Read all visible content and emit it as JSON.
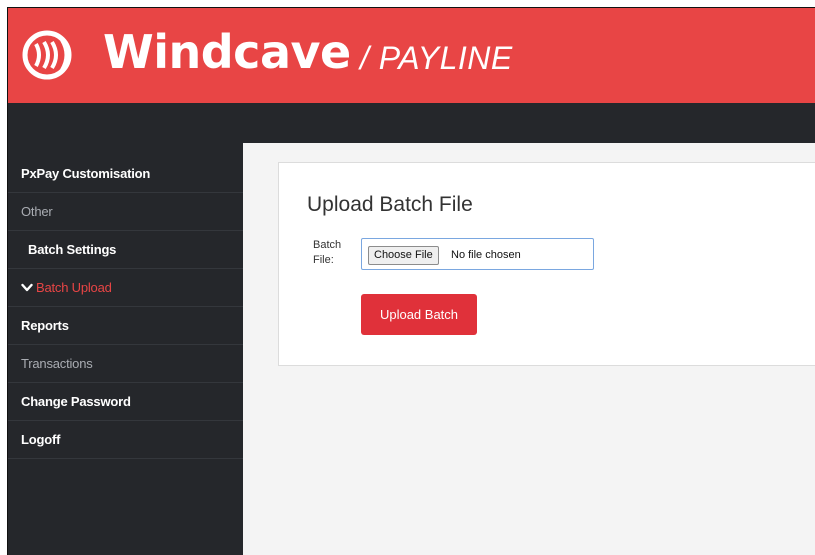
{
  "brand": {
    "name": "Windcave",
    "sub": "/ PAYLINE",
    "color": "#e84545"
  },
  "sidebar": {
    "items": [
      {
        "label": "PxPay Customisation"
      },
      {
        "label": "Other"
      },
      {
        "label": "Batch Settings"
      },
      {
        "label": "Batch Upload",
        "icon": "chevron-down-icon"
      },
      {
        "label": "Reports"
      },
      {
        "label": "Transactions"
      },
      {
        "label": "Change Password"
      },
      {
        "label": "Logoff"
      }
    ]
  },
  "main": {
    "title": "Upload Batch File",
    "field_label": "Batch File:",
    "file_button": "Choose File",
    "file_status": "No file chosen",
    "submit_label": "Upload Batch"
  }
}
